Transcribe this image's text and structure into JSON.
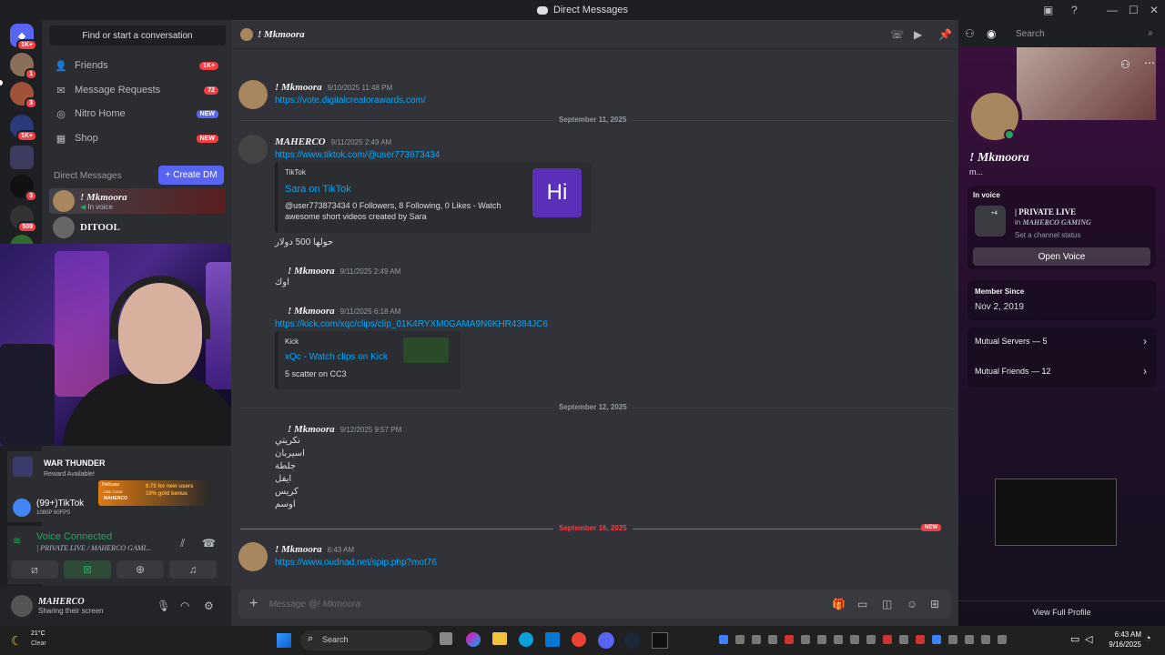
{
  "window": {
    "title": "Direct Messages"
  },
  "servers": [
    {
      "badge": "1K+"
    },
    {
      "badge": "1"
    },
    {
      "badge": "3"
    },
    {
      "badge": "1K+"
    },
    {
      "badge": ""
    },
    {
      "badge": "3"
    },
    {
      "badge": "508"
    }
  ],
  "dm_sidebar": {
    "find_label": "Find or start a conversation",
    "nav": [
      {
        "label": "Friends",
        "badge": "1K+"
      },
      {
        "label": "Message Requests",
        "badge": "72"
      },
      {
        "label": "Nitro Home",
        "badge": "NEW"
      },
      {
        "label": "Shop",
        "badge": "NEW"
      }
    ],
    "dm_heading": "Direct Messages",
    "create_dm": "Create DM",
    "dms": [
      {
        "name": "! Mkmoora",
        "status": "In voice"
      },
      {
        "name": "DITOOL",
        "status": ""
      }
    ]
  },
  "overlay": {
    "game_title": "WAR THUNDER",
    "game_sub": "Reward Available!",
    "promo_line1": "0.75 for new users",
    "promo_line2": "10% gold bonus",
    "promo_code": "MAHERCO",
    "promo_brand": "Hellcase",
    "promo_use": "USE CODE",
    "stream_title": "(99+)TikTok",
    "stream_quality": "1080P 60FPS"
  },
  "voice": {
    "status": "Voice Connected",
    "channel": "| PRIVATE LIVE / MAHERCO GAMI..."
  },
  "user": {
    "name": "MAHERCO",
    "status": "Sharing their screen"
  },
  "chat": {
    "header_name": "! Mkmoora",
    "search_placeholder": "Search",
    "composer_placeholder": "Message @! Mkmoora",
    "messages": [
      {
        "name": "! Mkmoora",
        "time": "9/10/2025 11:48 PM",
        "link": "https://vote.digitalcreatorawards.com/"
      },
      {
        "divider": "September 11, 2025"
      },
      {
        "name": "MAHERCO",
        "time": "9/11/2025 2:49 AM",
        "link": "https://www.tiktok.com/@user773873434",
        "embed": {
          "provider": "TikTok",
          "title": "Sara on TikTok",
          "desc": "@user773873434 0 Followers, 8 Following, 0 Likes - Watch awesome short videos created by Sara",
          "thumb": "Hi"
        },
        "text": "حولها 500 دولار"
      },
      {
        "name": "! Mkmoora",
        "time": "9/11/2025 2:49 AM",
        "text": "اوك"
      },
      {
        "name": "! Mkmoora",
        "time": "9/11/2025 6:18 AM",
        "link": "https://kick.com/xqc/clips/clip_01K4RYXM0GAMA9N6KHR4384JC6",
        "embed": {
          "provider": "Kick",
          "title": "xQc - Watch clips on Kick",
          "desc": "5 scatter on CC3"
        }
      },
      {
        "divider": "September 12, 2025"
      },
      {
        "name": "! Mkmoora",
        "time": "9/12/2025 9:57 PM",
        "lines": [
          "نكريتي",
          "اسيربان",
          "جلطة",
          "ايفل",
          "كريس",
          "اوسم"
        ]
      },
      {
        "divider": "September 16, 2025",
        "new": "NEW"
      },
      {
        "name": "! Mkmoora",
        "time": "6:43 AM",
        "link": "https://www.oudnad.net/spip.php?mot76"
      }
    ]
  },
  "profile": {
    "name": "! Mkmoora",
    "tag": "m...",
    "in_voice_label": "In voice",
    "voice_channel": "| PRIVATE LIVE",
    "voice_server_prefix": "in",
    "voice_server": "MAHERCO GAMING",
    "voice_count": "+4",
    "set_status": "Set a channel status",
    "open_voice": "Open Voice",
    "member_since_label": "Member Since",
    "member_since": "Nov 2, 2019",
    "mutual_servers": "Mutual Servers — 5",
    "mutual_friends": "Mutual Friends — 12",
    "view_full": "View Full Profile"
  },
  "taskbar": {
    "weather_temp": "21°C",
    "weather_desc": "Clear",
    "search": "Search",
    "time": "6:43 AM",
    "date": "9/16/2025"
  },
  "colors": {
    "blurple": "#5865f2",
    "red": "#f23f43",
    "link": "#00a8fc",
    "green": "#23a55a"
  }
}
